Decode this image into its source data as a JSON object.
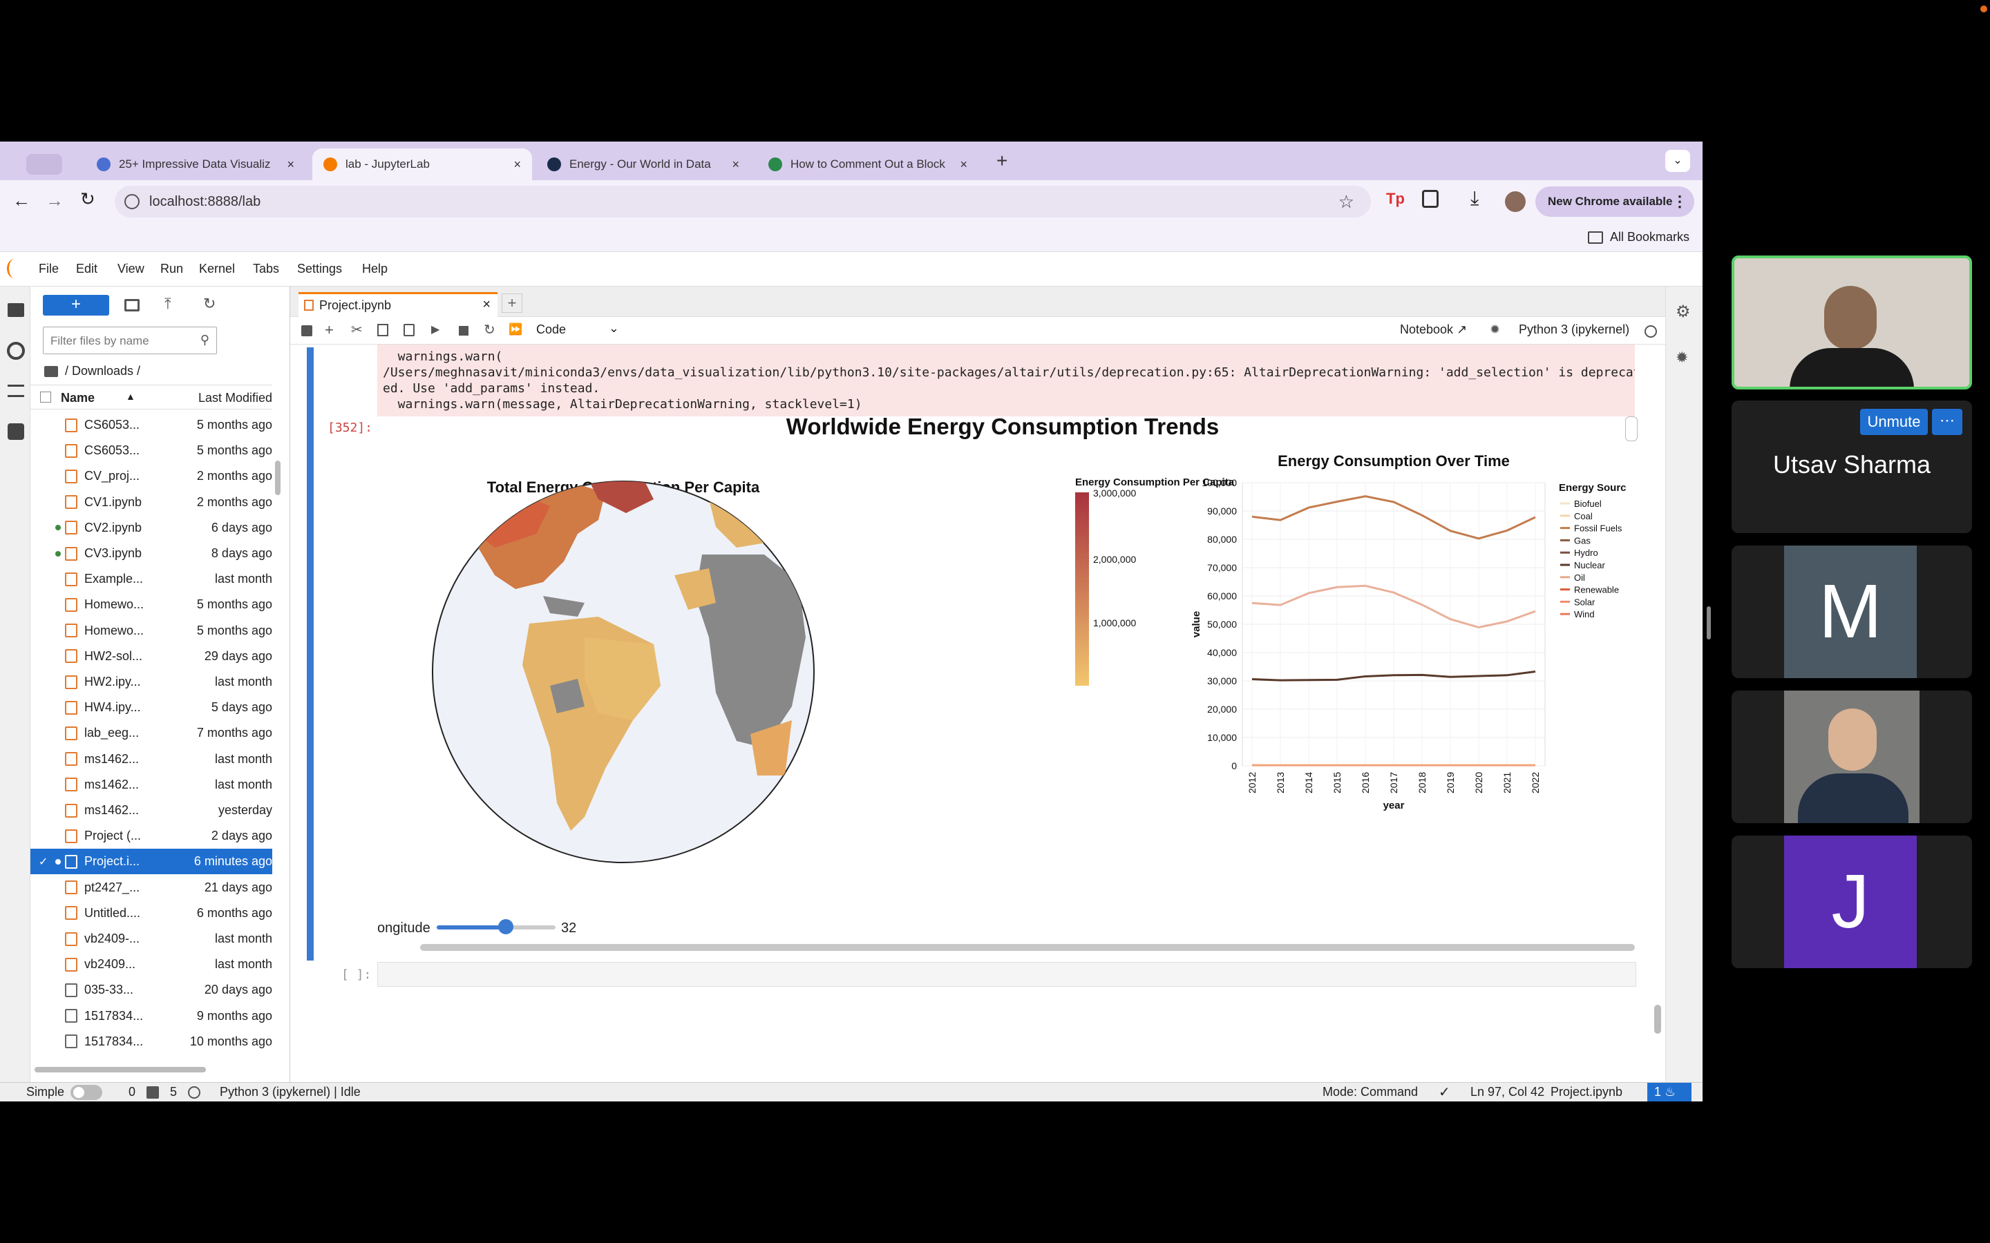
{
  "browser": {
    "tabs": [
      {
        "title": "25+ Impressive Data Visualiz",
        "color": "#4a6fd0"
      },
      {
        "title": "lab - JupyterLab",
        "color": "#f57c00"
      },
      {
        "title": "Energy - Our World in Data",
        "color": "#1a2b4a"
      },
      {
        "title": "How to Comment Out a Block",
        "color": "#2a8a4a"
      }
    ],
    "url": "localhost:8888/lab",
    "new_chrome": "New Chrome available",
    "all_bookmarks": "All Bookmarks"
  },
  "jupyter": {
    "menu": [
      "File",
      "Edit",
      "View",
      "Run",
      "Kernel",
      "Tabs",
      "Settings",
      "Help"
    ],
    "filter_placeholder": "Filter files by name",
    "path": "/ Downloads /",
    "col_name": "Name",
    "col_modified": "Last Modified",
    "files": [
      {
        "name": "CS6053...",
        "modified": "5 months ago",
        "type": "nb",
        "dot": false
      },
      {
        "name": "CS6053...",
        "modified": "5 months ago",
        "type": "nb",
        "dot": false
      },
      {
        "name": "CV_proj...",
        "modified": "2 months ago",
        "type": "nb",
        "dot": false
      },
      {
        "name": "CV1.ipynb",
        "modified": "2 months ago",
        "type": "nb",
        "dot": false
      },
      {
        "name": "CV2.ipynb",
        "modified": "6 days ago",
        "type": "nb",
        "dot": true
      },
      {
        "name": "CV3.ipynb",
        "modified": "8 days ago",
        "type": "nb",
        "dot": true
      },
      {
        "name": "Example...",
        "modified": "last month",
        "type": "nb",
        "dot": false
      },
      {
        "name": "Homewo...",
        "modified": "5 months ago",
        "type": "nb",
        "dot": false
      },
      {
        "name": "Homewo...",
        "modified": "5 months ago",
        "type": "nb",
        "dot": false
      },
      {
        "name": "HW2-sol...",
        "modified": "29 days ago",
        "type": "nb",
        "dot": false
      },
      {
        "name": "HW2.ipy...",
        "modified": "last month",
        "type": "nb",
        "dot": false
      },
      {
        "name": "HW4.ipy...",
        "modified": "5 days ago",
        "type": "nb",
        "dot": false
      },
      {
        "name": "lab_eeg...",
        "modified": "7 months ago",
        "type": "nb",
        "dot": false
      },
      {
        "name": "ms1462...",
        "modified": "last month",
        "type": "nb",
        "dot": false
      },
      {
        "name": "ms1462...",
        "modified": "last month",
        "type": "nb",
        "dot": false
      },
      {
        "name": "ms1462...",
        "modified": "yesterday",
        "type": "nb",
        "dot": false
      },
      {
        "name": "Project (...",
        "modified": "2 days ago",
        "type": "nb",
        "dot": false
      },
      {
        "name": "Project.i...",
        "modified": "6 minutes ago",
        "type": "nb",
        "dot": true,
        "selected": true
      },
      {
        "name": "pt2427_...",
        "modified": "21 days ago",
        "type": "nb",
        "dot": false
      },
      {
        "name": "Untitled....",
        "modified": "6 months ago",
        "type": "nb",
        "dot": false
      },
      {
        "name": "vb2409-...",
        "modified": "last month",
        "type": "nb",
        "dot": false
      },
      {
        "name": "vb2409...",
        "modified": "last month",
        "type": "nb",
        "dot": false
      },
      {
        "name": "035-33...",
        "modified": "20 days ago",
        "type": "file",
        "dot": false
      },
      {
        "name": "1517834...",
        "modified": "9 months ago",
        "type": "file",
        "dot": false
      },
      {
        "name": "1517834...",
        "modified": "10 months ago",
        "type": "file",
        "dot": false
      }
    ],
    "doc_tab": "Project.ipynb",
    "cell_type": "Code",
    "notebook_label": "Notebook",
    "kernel": "Python 3 (ipykernel)",
    "error_lines": [
      "  warnings.warn(",
      "/Users/meghnasavit/miniconda3/envs/data_visualization/lib/python3.10/site-packages/altair/utils/deprecation.py:65: AltairDeprecationWarning: 'add_selection' is deprecat",
      "ed. Use 'add_params' instead.",
      "  warnings.warn(message, AltairDeprecationWarning, stacklevel=1)"
    ],
    "exec_count": "[352]:",
    "empty_prompt": "[ ]:",
    "slider_label": "ongitude",
    "slider_value": "32",
    "slider_fraction": 0.58,
    "status": {
      "mode_simple": "Simple",
      "count_a": "0",
      "count_b": "5",
      "kernel_state": "Python 3 (ipykernel) | Idle",
      "mode": "Mode: Command",
      "cursor": "Ln 97, Col 42",
      "file": "Project.ipynb",
      "notifications": "1"
    }
  },
  "chart_data": [
    {
      "type": "table",
      "title": "Worldwide Energy Consumption Trends"
    },
    {
      "type": "map",
      "title": "Total Energy Consumption Per Capita",
      "legend_title": "Energy Consumption Per Capita",
      "legend_ticks": [
        "3,000,000",
        "2,000,000",
        "1,000,000"
      ],
      "color_range": [
        "#f2c66e",
        "#a8323e"
      ],
      "projection": "orthographic"
    },
    {
      "type": "line",
      "title": "Energy Consumption Over Time",
      "xlabel": "year",
      "ylabel": "value",
      "ylim": [
        0,
        100000
      ],
      "y_ticks": [
        "100,000",
        "90,000",
        "80,000",
        "70,000",
        "60,000",
        "50,000",
        "40,000",
        "30,000",
        "20,000",
        "10,000",
        "0"
      ],
      "x": [
        "2012",
        "2013",
        "2014",
        "2015",
        "2016",
        "2017",
        "2018",
        "2019",
        "2020",
        "2021",
        "2022"
      ],
      "legend_title": "Energy Sourc",
      "legend": [
        {
          "name": "Biofuel",
          "color": "#f6e3c8"
        },
        {
          "name": "Coal",
          "color": "#f3d6a8"
        },
        {
          "name": "Fossil Fuels",
          "color": "#c37c4e"
        },
        {
          "name": "Gas",
          "color": "#8c5a3c"
        },
        {
          "name": "Hydro",
          "color": "#7a5040"
        },
        {
          "name": "Nuclear",
          "color": "#5a3a2c"
        },
        {
          "name": "Oil",
          "color": "#e9a88a"
        },
        {
          "name": "Renewable",
          "color": "#e05a3a"
        },
        {
          "name": "Solar",
          "color": "#f08a6a"
        },
        {
          "name": "Wind",
          "color": "#e97a5a"
        }
      ],
      "series": [
        {
          "name": "Fossil Fuels",
          "color": "#c37c4e",
          "values": [
            88000,
            86800,
            91200,
            93300,
            95200,
            93200,
            88500,
            83000,
            80300,
            83100,
            87800
          ]
        },
        {
          "name": "Oil",
          "color": "#eab09a",
          "values": [
            57500,
            56800,
            61000,
            63100,
            63600,
            61200,
            56900,
            51800,
            48900,
            51000,
            54600
          ]
        },
        {
          "name": "Nuclear",
          "color": "#5a3a2c",
          "values": [
            30600,
            30200,
            30300,
            30400,
            31600,
            32000,
            32100,
            31400,
            31700,
            32000,
            33300
          ]
        },
        {
          "name": "Renewable",
          "color": "#f3a27a",
          "values": [
            200,
            200,
            200,
            200,
            200,
            200,
            200,
            200,
            200,
            200,
            200
          ]
        }
      ]
    }
  ],
  "participants": {
    "name": "Utsav Sharma",
    "unmute": "Unmute",
    "initial_m": "M",
    "initial_j": "J"
  }
}
